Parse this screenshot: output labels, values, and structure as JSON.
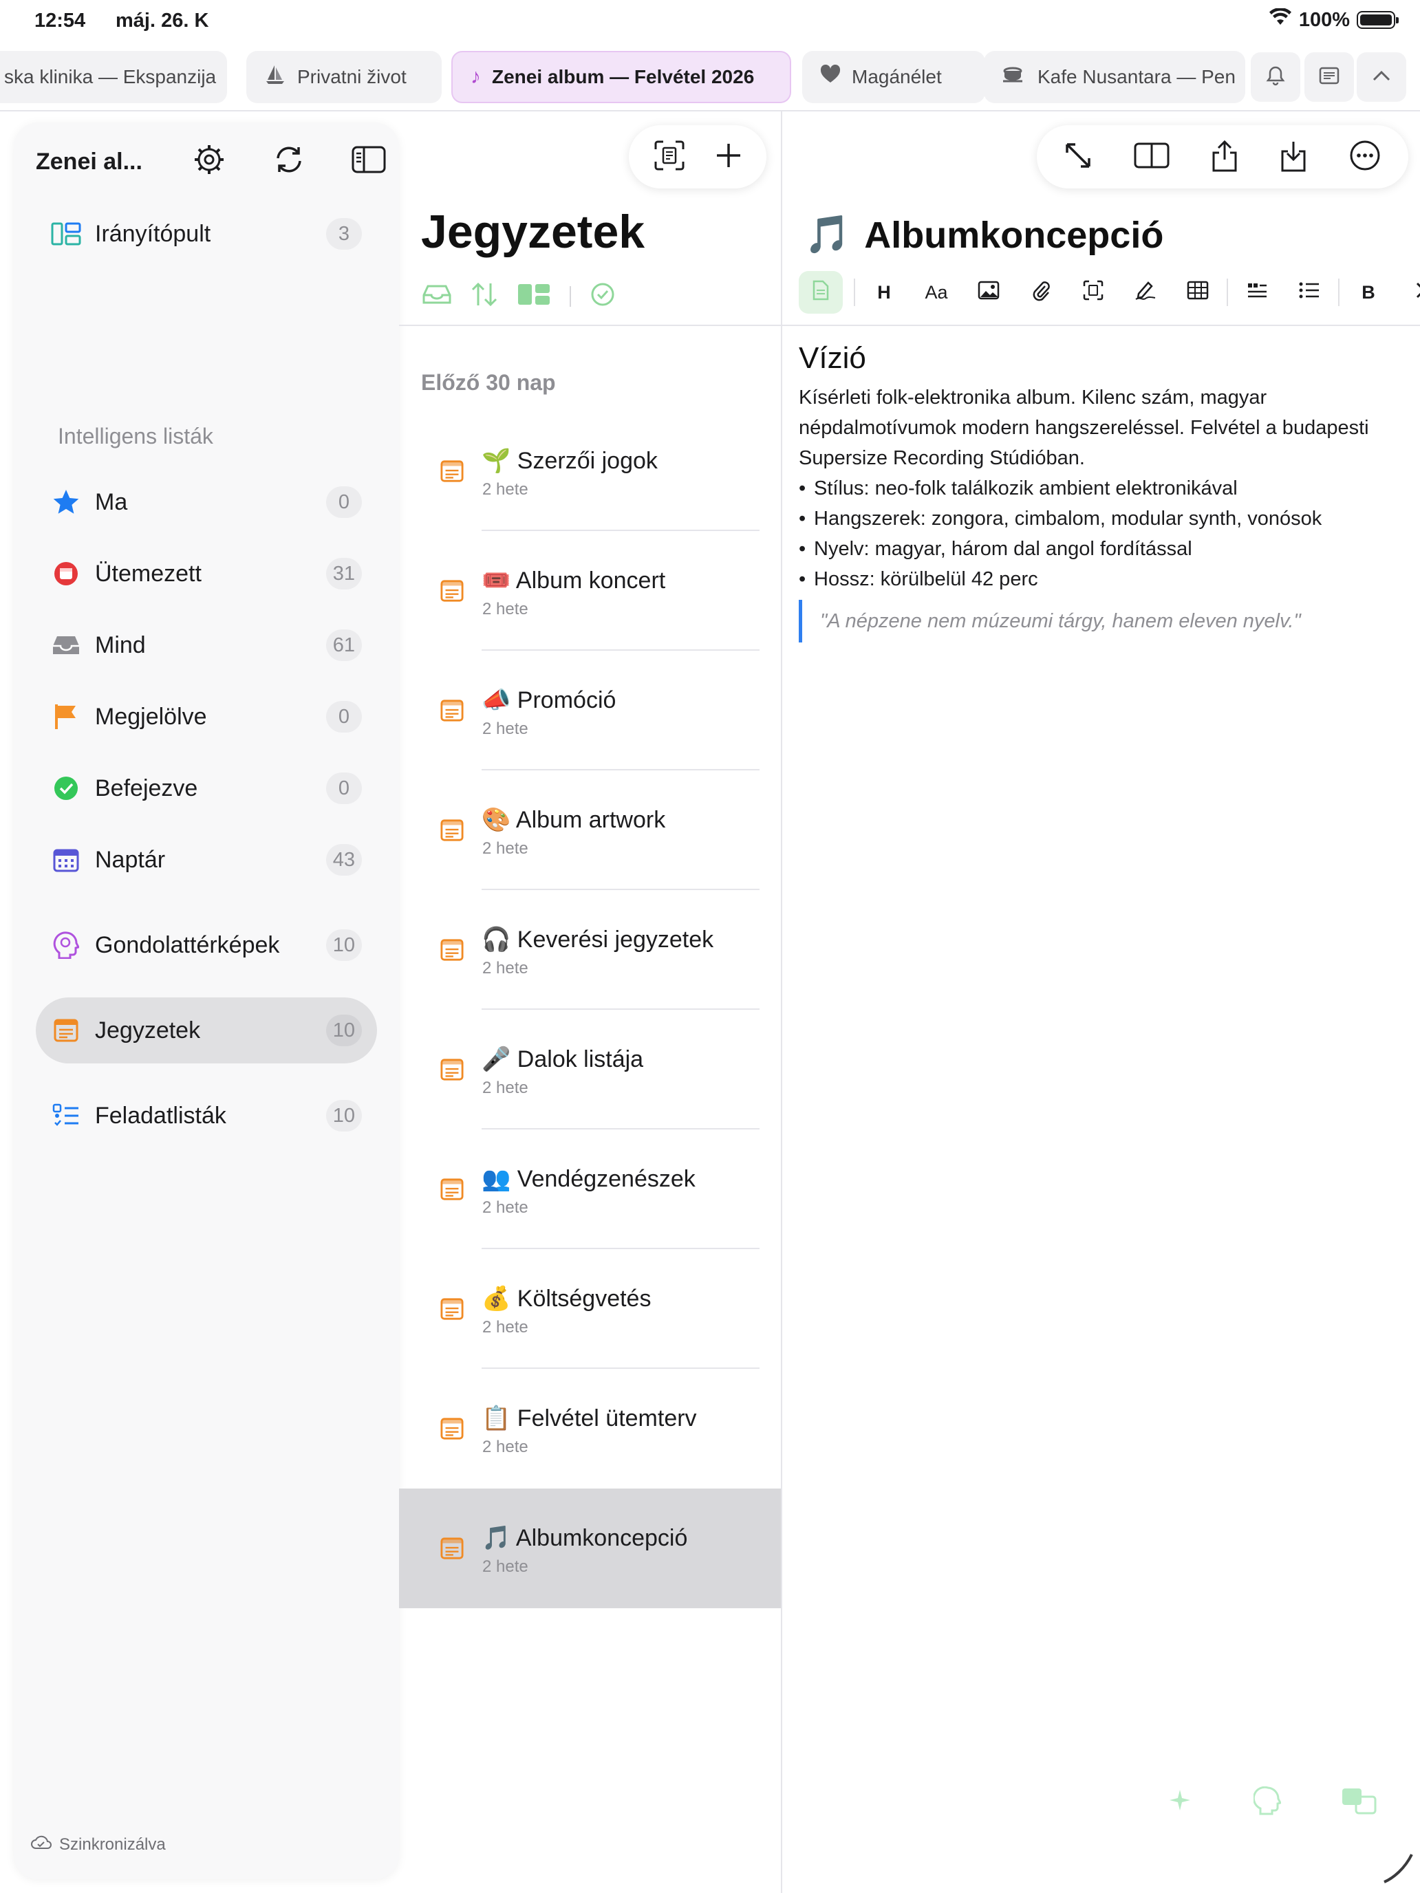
{
  "status_bar": {
    "time": "12:54",
    "date": "máj. 26. K",
    "battery": "100%"
  },
  "tabs": [
    {
      "label": "ska klinika — Ekspanzija",
      "icon": "none"
    },
    {
      "label": "Privatni život",
      "icon": "sailboat-icon"
    },
    {
      "label": "Zenei album — Felvétel 2026",
      "icon": "music-note-icon",
      "active": true
    },
    {
      "label": "Magánélet",
      "icon": "heart-icon"
    },
    {
      "label": "Kafe Nusantara — Pen",
      "icon": "coffee-cup-icon"
    }
  ],
  "sidebar": {
    "title": "Zenei al...",
    "dashboard": {
      "label": "Irányítópult",
      "count": "3"
    },
    "smart_lists_label": "Intelligens listák",
    "smart_lists": [
      {
        "label": "Ma",
        "count": "0",
        "icon": "star-icon",
        "color": "#1e7cf2"
      },
      {
        "label": "Ütemezett",
        "count": "31",
        "icon": "calendar-clock-icon",
        "color": "#e5383b"
      },
      {
        "label": "Mind",
        "count": "61",
        "icon": "tray-icon",
        "color": "#8e8e93"
      },
      {
        "label": "Megjelölve",
        "count": "0",
        "icon": "flag-icon",
        "color": "#f5922a"
      },
      {
        "label": "Befejezve",
        "count": "0",
        "icon": "checkmark-circle-icon",
        "color": "#34c759"
      },
      {
        "label": "Naptár",
        "count": "43",
        "icon": "calendar-grid-icon",
        "color": "#5856d6"
      }
    ],
    "groups": [
      {
        "label": "Gondolattérképek",
        "count": "10",
        "icon": "brain-head-icon",
        "color": "#af52de"
      },
      {
        "label": "Jegyzetek",
        "count": "10",
        "icon": "note-icon",
        "color": "#f08a24",
        "selected": true
      },
      {
        "label": "Feladatlisták",
        "count": "10",
        "icon": "checklist-icon",
        "color": "#1e7cf2"
      }
    ],
    "sync_status": "Szinkronizálva"
  },
  "notes_list": {
    "title": "Jegyzetek",
    "group_label": "Előző 30 nap",
    "notes": [
      {
        "emoji": "🌱",
        "title": "Szerzői jogok",
        "date": "2 hete"
      },
      {
        "emoji": "🎟️",
        "title": "Album koncert",
        "date": "2 hete"
      },
      {
        "emoji": "📣",
        "title": "Promóció",
        "date": "2 hete"
      },
      {
        "emoji": "🎨",
        "title": "Album artwork",
        "date": "2 hete"
      },
      {
        "emoji": "🎧",
        "title": "Keverési jegyzetek",
        "date": "2 hete"
      },
      {
        "emoji": "🎤",
        "title": "Dalok listája",
        "date": "2 hete"
      },
      {
        "emoji": "👥",
        "title": "Vendégzenészek",
        "date": "2 hete"
      },
      {
        "emoji": "💰",
        "title": "Költségvetés",
        "date": "2 hete"
      },
      {
        "emoji": "📋",
        "title": "Felvétel ütemterv",
        "date": "2 hete"
      },
      {
        "emoji": "🎵",
        "title": "Albumkoncepció",
        "date": "2 hete",
        "selected": true
      }
    ]
  },
  "editor": {
    "title_emoji": "🎵",
    "title": "Albumkoncepció",
    "format_bar": {
      "heading": "H",
      "font": "Aa",
      "bold": "B"
    },
    "heading": "Vízió",
    "paragraph": "Kísérleti folk-elektronika album. Kilenc szám, magyar népdalmotívumok modern hangszereléssel. Felvétel a budapesti Supersize Recording Stúdióban.",
    "bullets": [
      "Stílus: neo-folk találkozik ambient elektronikával",
      "Hangszerek: zongora, cimbalom, modular synth, vonósok",
      "Nyelv: magyar, három dal angol fordítással",
      "Hossz: körülbelül 42 perc"
    ],
    "quote": "\"A népzene nem múzeumi tárgy, hanem eleven nyelv.\""
  },
  "colors": {
    "accent_tab_bg": "#f3e4f9",
    "note_orange": "#f08a24",
    "quote_bar": "#2f7ff0"
  }
}
